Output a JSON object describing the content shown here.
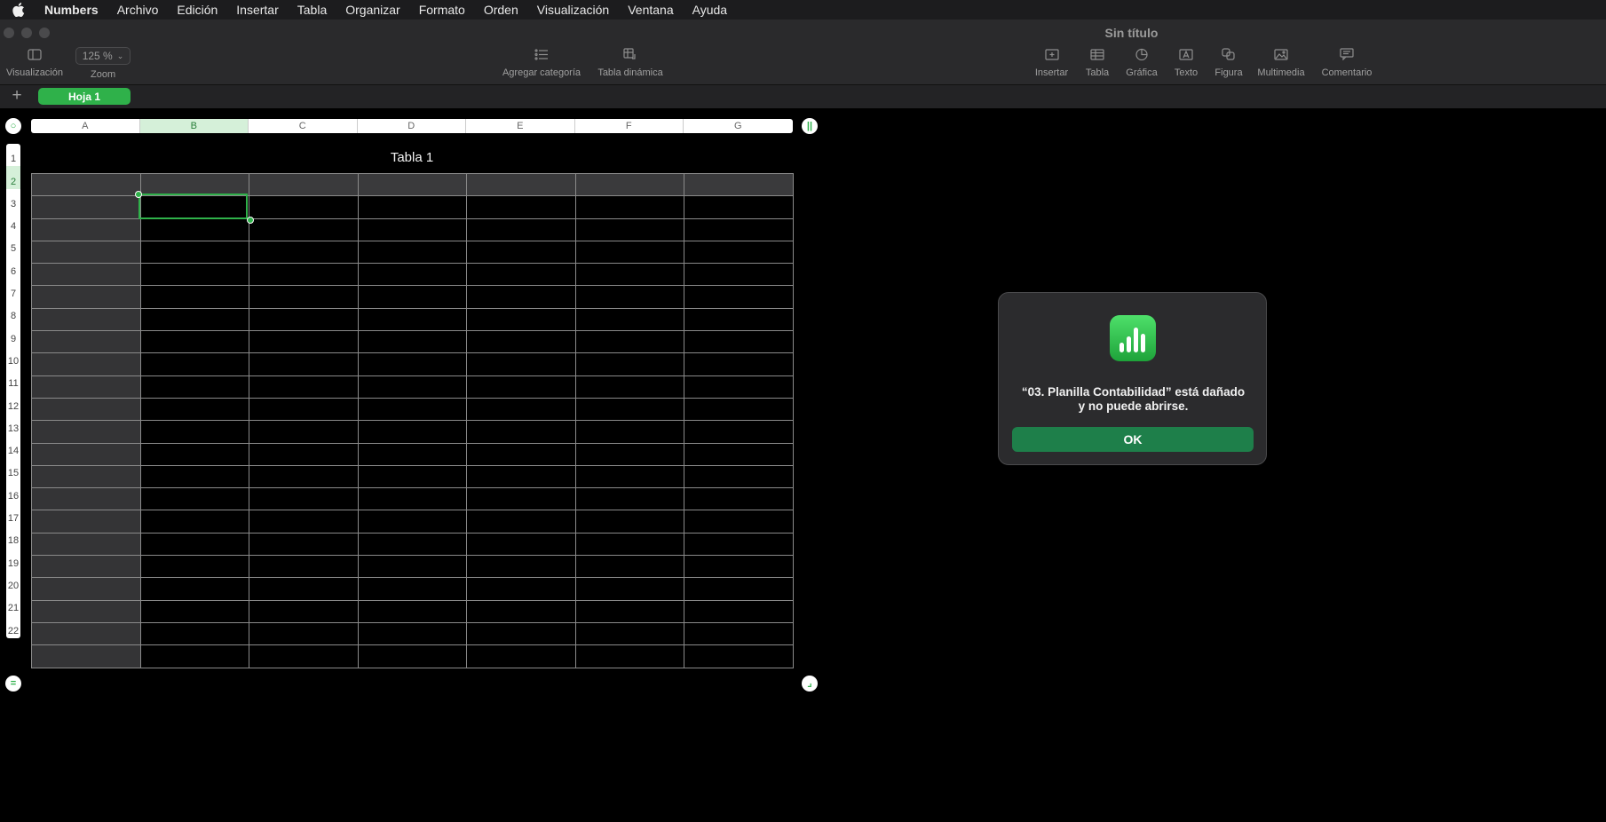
{
  "menubar": {
    "app": "Numbers",
    "items": [
      "Archivo",
      "Edición",
      "Insertar",
      "Tabla",
      "Organizar",
      "Formato",
      "Orden",
      "Visualización",
      "Ventana",
      "Ayuda"
    ]
  },
  "window": {
    "title": "Sin título"
  },
  "toolbar": {
    "view_label": "Visualización",
    "zoom_value": "125 %",
    "zoom_label": "Zoom",
    "add_category_label": "Agregar categoría",
    "pivot_label": "Tabla dinámica",
    "insert_label": "Insertar",
    "table_label": "Tabla",
    "chart_label": "Gráfica",
    "text_label": "Texto",
    "shape_label": "Figura",
    "media_label": "Multimedia",
    "comment_label": "Comentario"
  },
  "sheets": {
    "add_symbol": "+",
    "active_tab": "Hoja 1"
  },
  "table": {
    "title": "Tabla 1",
    "columns": [
      "A",
      "B",
      "C",
      "D",
      "E",
      "F",
      "G"
    ],
    "rows": [
      "1",
      "2",
      "3",
      "4",
      "5",
      "6",
      "7",
      "8",
      "9",
      "10",
      "11",
      "12",
      "13",
      "14",
      "15",
      "16",
      "17",
      "18",
      "19",
      "20",
      "21",
      "22"
    ],
    "selected_column": "B",
    "selected_row": "2"
  },
  "dialog": {
    "message_line1": "“03. Planilla Contabilidad” está dañado",
    "message_line2": "y no puede abrirse.",
    "ok_label": "OK"
  },
  "colors": {
    "accent": "#2fb14a",
    "ok_button": "#1e7f4a"
  }
}
